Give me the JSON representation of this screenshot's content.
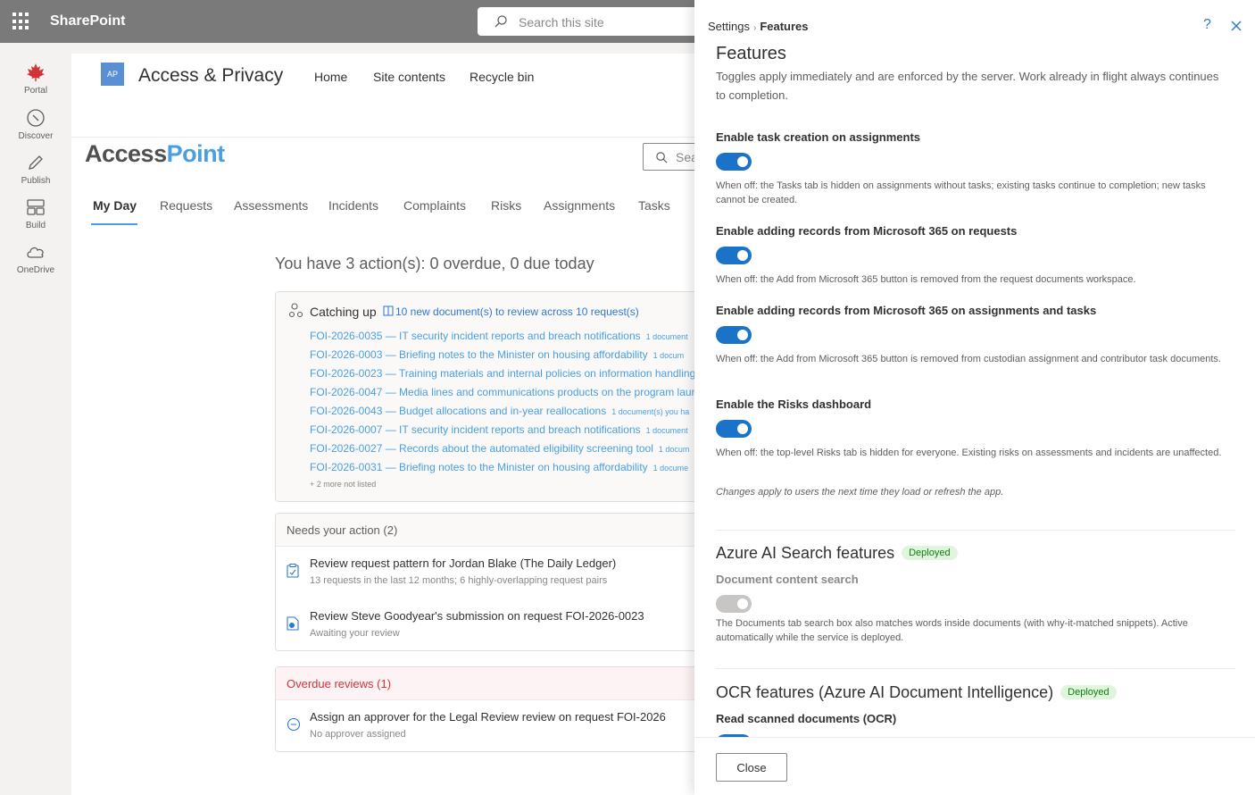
{
  "suite": {
    "brand": "SharePoint",
    "search_placeholder": "Search this site"
  },
  "appbar": [
    {
      "label": "Portal",
      "icon": "maple-leaf-icon"
    },
    {
      "label": "Discover",
      "icon": "compass-icon"
    },
    {
      "label": "Publish",
      "icon": "pen-icon"
    },
    {
      "label": "Build",
      "icon": "blocks-icon"
    },
    {
      "label": "OneDrive",
      "icon": "cloud-icon"
    }
  ],
  "site": {
    "logo_text": "AP",
    "title": "Access & Privacy",
    "nav": [
      "Home",
      "Site contents",
      "Recycle bin"
    ]
  },
  "app": {
    "logo_a": "Access",
    "logo_b": "Point",
    "search_placeholder": "Sea",
    "tabs": [
      "My Day",
      "Requests",
      "Assessments",
      "Incidents",
      "Complaints",
      "Risks",
      "Assignments",
      "Tasks"
    ],
    "summary": "You have 3 action(s): 0 overdue, 0 due today"
  },
  "catching_up": {
    "title": "Catching up",
    "link": "10 new document(s) to review across 10 request(s)",
    "rows": [
      {
        "text": "FOI-2026-0035 — IT security incident reports and breach notifications",
        "extra": "1 document"
      },
      {
        "text": "FOI-2026-0003 — Briefing notes to the Minister on housing affordability",
        "extra": "1 docum"
      },
      {
        "text": "FOI-2026-0023 — Training materials and internal policies on information handling",
        "extra": ""
      },
      {
        "text": "FOI-2026-0047 — Media lines and communications products on the program laun",
        "extra": ""
      },
      {
        "text": "FOI-2026-0043 — Budget allocations and in-year reallocations",
        "extra": "1 document(s) you ha"
      },
      {
        "text": "FOI-2026-0007 — IT security incident reports and breach notifications",
        "extra": "1 document"
      },
      {
        "text": "FOI-2026-0027 — Records about the automated eligibility screening tool",
        "extra": "1 docum"
      },
      {
        "text": "FOI-2026-0031 — Briefing notes to the Minister on housing affordability",
        "extra": "1 docume"
      }
    ],
    "more": "+ 2 more not listed"
  },
  "needs_action": {
    "header": "Needs your action (2)",
    "items": [
      {
        "title": "Review request pattern for Jordan Blake (The Daily Ledger)",
        "sub": "13 requests in the last 12 months; 6 highly-overlapping request pairs"
      },
      {
        "title": "Review Steve Goodyear's submission on request FOI-2026-0023",
        "sub": "Awaiting your review"
      }
    ]
  },
  "overdue": {
    "header": "Overdue reviews (1)",
    "items": [
      {
        "title": "Assign an approver for the Legal Review review on request FOI-2026",
        "sub": "No approver assigned"
      }
    ]
  },
  "panel": {
    "crumb_root": "Settings",
    "crumb_current": "Features",
    "help": "?",
    "title": "Features",
    "description": "Toggles apply immediately and are enforced by the server. Work already in flight always continues to completion.",
    "settings": [
      {
        "label": "Enable task creation on assignments",
        "on": true,
        "help": "When off: the Tasks tab is hidden on assignments without tasks; existing tasks continue to completion; new tasks cannot be created."
      },
      {
        "label": "Enable adding records from Microsoft 365 on requests",
        "on": true,
        "help": "When off: the Add from Microsoft 365 button is removed from the request documents workspace."
      },
      {
        "label": "Enable adding records from Microsoft 365 on assignments and tasks",
        "on": true,
        "help": "When off: the Add from Microsoft 365 button is removed from custodian assignment and contributor task documents."
      },
      {
        "label": "Enable the Risks dashboard",
        "on": true,
        "help": "When off: the top-level Risks tab is hidden for everyone. Existing risks on assessments and incidents are unaffected."
      }
    ],
    "note": "Changes apply to users the next time they load or refresh the app.",
    "ai_search": {
      "title": "Azure AI Search features",
      "badge": "Deployed",
      "sub_label": "Document content search",
      "on": false,
      "help": "The Documents tab search box also matches words inside documents (with why-it-matched snippets). Active automatically while the service is deployed."
    },
    "ocr": {
      "title": "OCR features (Azure AI Document Intelligence)",
      "badge": "Deployed",
      "sub_label": "Read scanned documents (OCR)",
      "on": true
    },
    "close_label": "Close"
  },
  "colors": {
    "accent": "#1a73c8",
    "link": "#4a9fe0",
    "deployed_bg": "#dff6dd",
    "deployed_fg": "#107c10",
    "overdue": "#d13438"
  }
}
